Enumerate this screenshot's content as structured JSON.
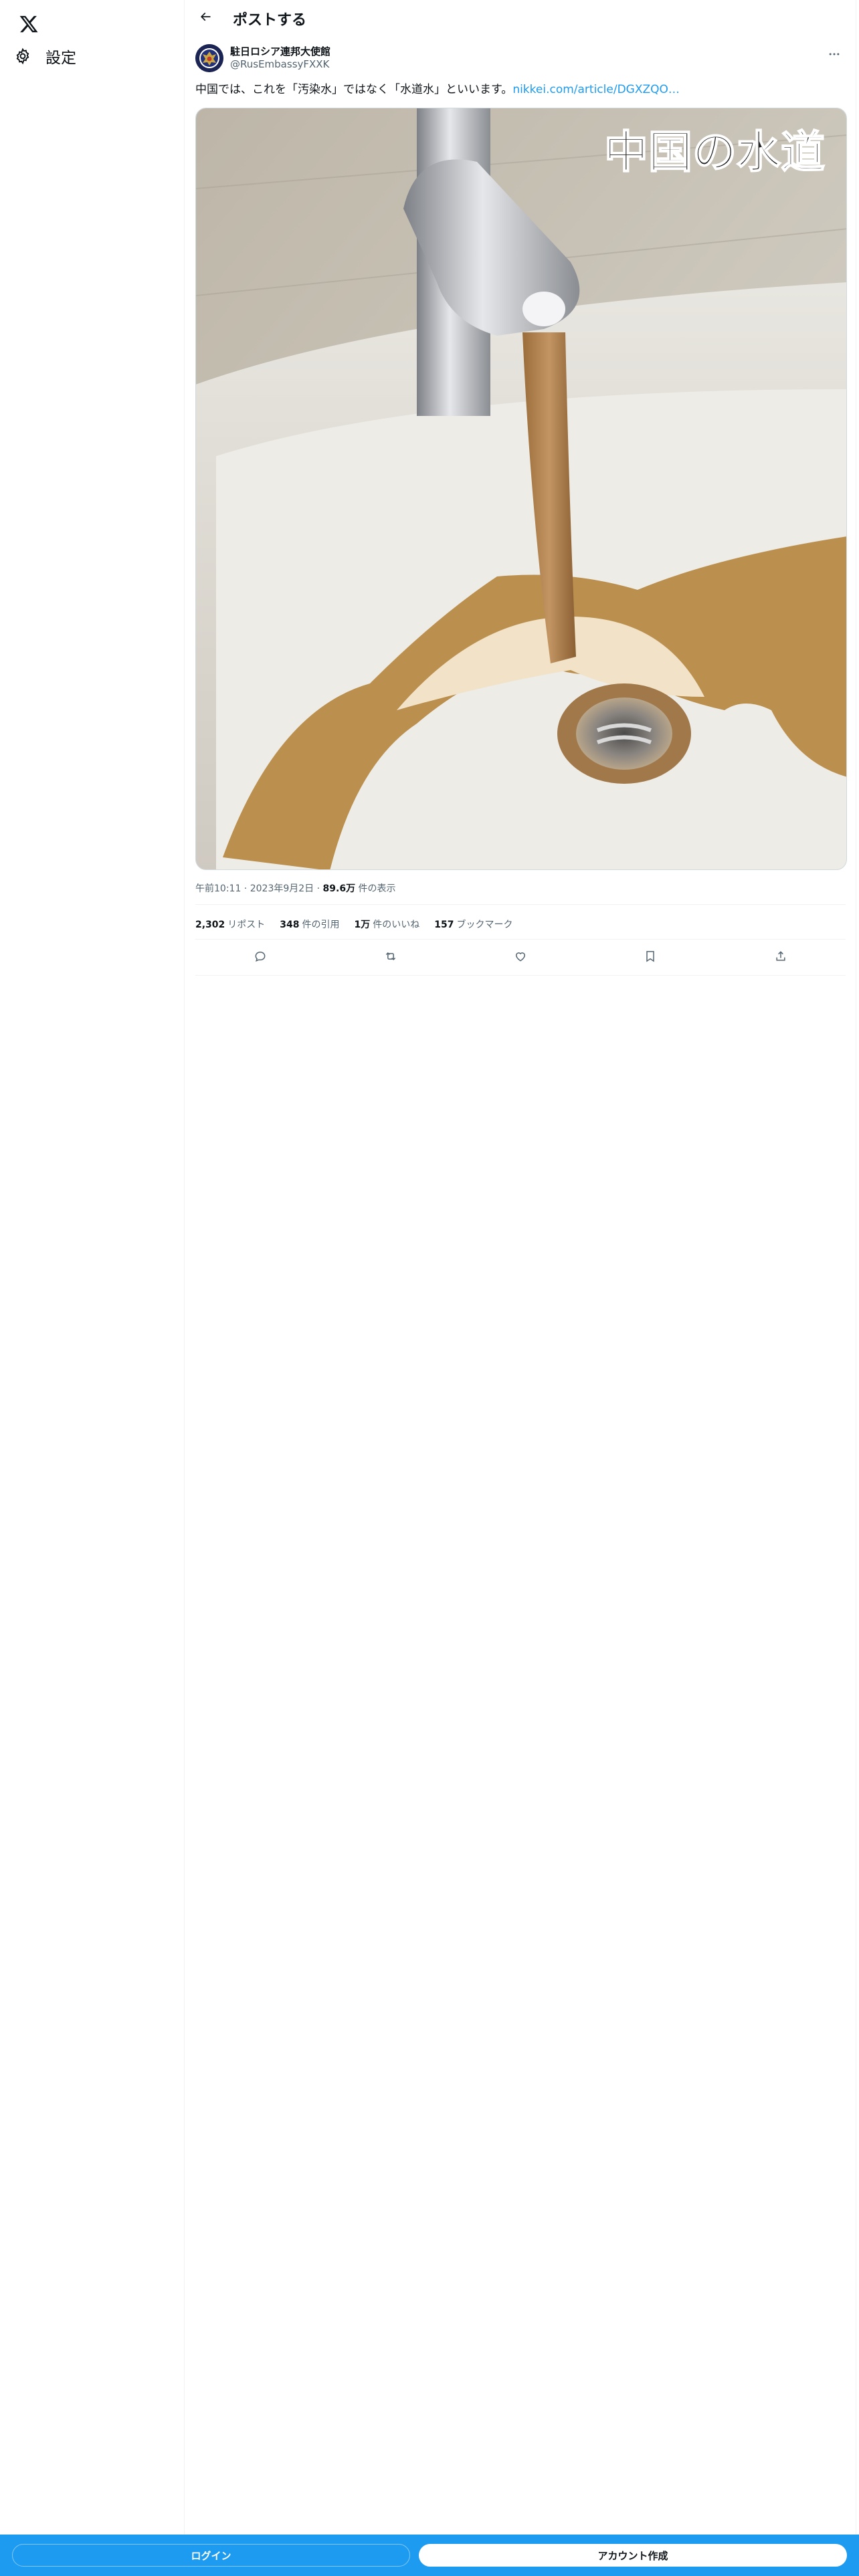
{
  "nav": {
    "logo_icon": "x-logo-icon",
    "settings_label": "設定",
    "settings_icon": "gear-icon"
  },
  "header": {
    "back_icon": "arrow-left-icon",
    "title": "ポストする"
  },
  "post": {
    "author_name": "駐日ロシア連邦大使館",
    "author_handle": "@RusEmbassyFXXK",
    "more_icon": "more-horizontal-icon",
    "text": "中国では、これを「汚染水」ではなく「水道水」といいます。",
    "link_text": "nikkei.com/article/DGXZQO…",
    "image_caption": "中国の水道",
    "time": "午前10:11",
    "date": "2023年9月2日",
    "views_count": "89.6万",
    "views_label": "件の表示",
    "stats": {
      "reposts_count": "2,302",
      "reposts_label": "リポスト",
      "quotes_count": "348",
      "quotes_label": "件の引用",
      "likes_count": "1万",
      "likes_label": "件のいいね",
      "bookmarks_count": "157",
      "bookmarks_label": "ブックマーク"
    },
    "actions": [
      "reply-icon",
      "repost-icon",
      "like-icon",
      "bookmark-icon",
      "share-icon"
    ]
  },
  "bottom_bar": {
    "login_label": "ログイン",
    "signup_label": "アカウント作成"
  },
  "colors": {
    "accent": "#1d9bf0",
    "text_primary": "#0f1419",
    "text_secondary": "#536471",
    "border": "#eff3f4"
  }
}
